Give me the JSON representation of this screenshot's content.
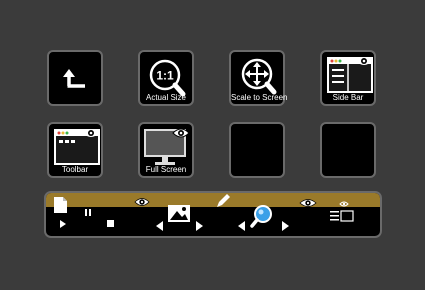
{
  "keys": [
    {
      "name": "back-key",
      "icon": "return-arrow-icon",
      "label": ""
    },
    {
      "name": "actual-size-key",
      "icon": "zoom-1to1-icon",
      "label": "Actual Size",
      "glyph": "1:1"
    },
    {
      "name": "scale-to-screen-key",
      "icon": "scale-to-screen-icon",
      "label": "Scale to Screen"
    },
    {
      "name": "side-bar-key",
      "icon": "sidebar-window-icon",
      "label": "Side Bar"
    },
    {
      "name": "toolbar-key",
      "icon": "toolbar-window-icon",
      "label": "Toolbar"
    },
    {
      "name": "full-screen-key",
      "icon": "monitor-icon",
      "label": "Full Screen"
    },
    {
      "name": "empty-key-1",
      "icon": "",
      "label": ""
    },
    {
      "name": "empty-key-2",
      "icon": "",
      "label": ""
    }
  ],
  "colors": {
    "background": "#3b3b3b",
    "key_fill": "#000000",
    "key_border": "#6a6a6a",
    "accent_gold": "#9a7a2a",
    "zoom_blue": "#3aa0e8",
    "traffic_red": "#e0443a",
    "traffic_yellow": "#e8b830",
    "traffic_green": "#3ab54a"
  },
  "bar": {
    "icons": [
      "document-icon",
      "play-icon",
      "pause-icon",
      "stop-icon",
      "eye-icon",
      "previous-arrow-icon",
      "image-icon",
      "next-arrow-icon",
      "pencil-icon",
      "previous-arrow-icon",
      "zoom-icon",
      "next-arrow-icon",
      "eye-icon",
      "list-view-icon"
    ]
  }
}
